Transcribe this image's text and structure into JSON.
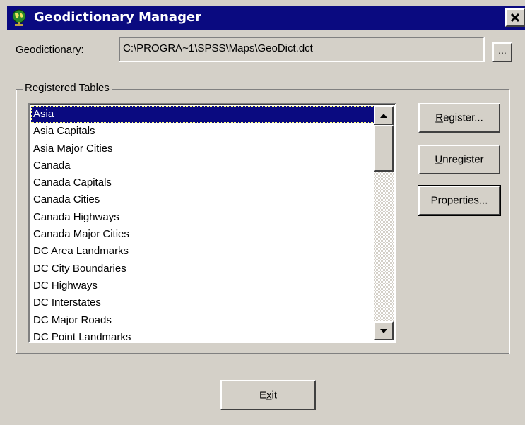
{
  "window": {
    "title": "Geodictionary Manager",
    "title_icon": "globe-icon",
    "close_icon": "close-icon"
  },
  "geodictionary": {
    "label_prefix": "",
    "label_mnemonic": "G",
    "label_rest": "eodictionary:",
    "path": "C:\\PROGRA~1\\SPSS\\Maps\\GeoDict.dct",
    "browse_label": "..."
  },
  "registered_tables": {
    "label_prefix": "Registered ",
    "label_mnemonic": "T",
    "label_rest": "ables",
    "selected_index": 0,
    "items": [
      "Asia",
      "Asia Capitals",
      "Asia Major Cities",
      "Canada",
      "Canada Capitals",
      "Canada Cities",
      "Canada Highways",
      "Canada Major Cities",
      "DC Area Landmarks",
      "DC City Boundaries",
      "DC Highways",
      "DC Interstates",
      "DC Major Roads",
      "DC Point Landmarks"
    ],
    "scroll_up_icon": "triangle-up-icon",
    "scroll_down_icon": "triangle-down-icon"
  },
  "buttons": {
    "register": {
      "mnemonic": "R",
      "rest": "egister..."
    },
    "unregister": {
      "mnemonic": "U",
      "rest": "nregister"
    },
    "properties": {
      "label": "Properties..."
    },
    "exit": {
      "pre": "E",
      "mnemonic": "x",
      "rest": "it"
    }
  },
  "colors": {
    "titlebar": "#0a0a80",
    "face": "#d4d0c8",
    "selection": "#0a0a80"
  }
}
